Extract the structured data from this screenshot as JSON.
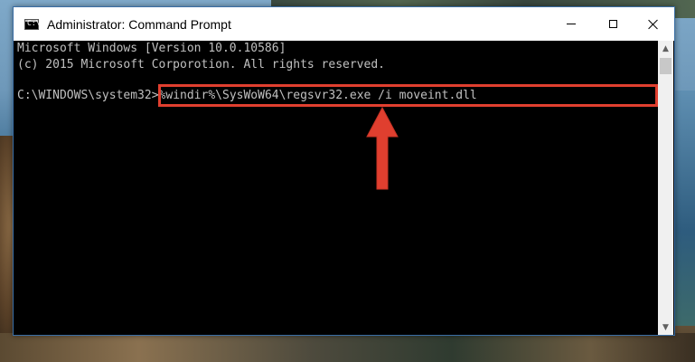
{
  "window": {
    "title": "Administrator: Command Prompt",
    "icon": "cmd-icon",
    "icon_text": "C:\\"
  },
  "console": {
    "lines": [
      "Microsoft Windows [Version 10.0.10586]",
      "(c) 2015 Microsoft Corporotion. All rights reserved."
    ],
    "prompt": "C:\\WINDOWS\\system32>",
    "command": "%windir%\\SysWoW64\\regsvr32.exe /i moveint.dll"
  },
  "annotation": {
    "highlight_color": "#e03f2f",
    "arrow_color": "#e03f2f",
    "arrow_icon": "up-arrow-icon"
  },
  "scrollbar": {
    "up_icon": "scroll-up-icon",
    "down_icon": "scroll-down-icon"
  }
}
